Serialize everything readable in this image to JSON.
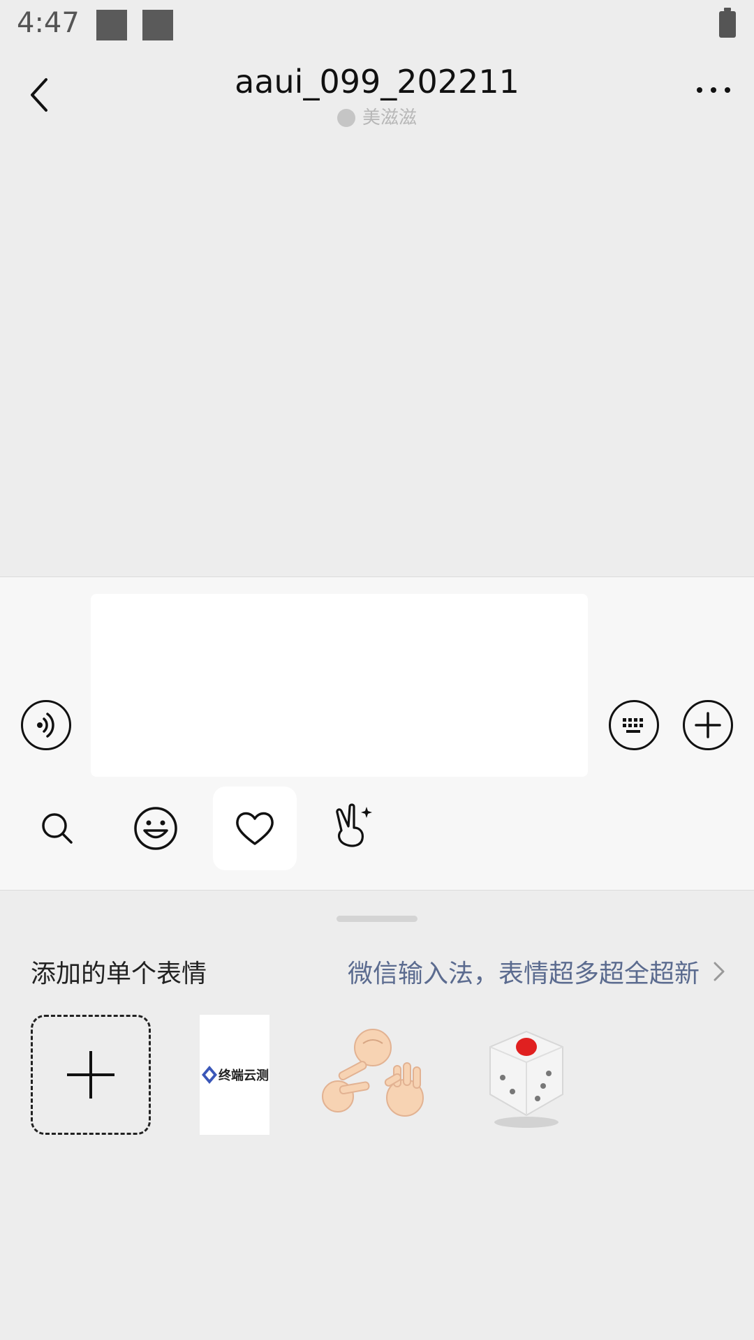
{
  "status": {
    "time": "4:47"
  },
  "header": {
    "title": "aaui_099_202211",
    "subtitle": "美滋滋"
  },
  "emoji_panel": {
    "section_title": "添加的单个表情",
    "promo_link": "微信输入法，表情超多超全超新",
    "stickers": [
      {
        "name": "add",
        "label": ""
      },
      {
        "name": "logo",
        "label": "终端云测"
      },
      {
        "name": "rock-paper-scissors",
        "label": ""
      },
      {
        "name": "dice",
        "label": ""
      }
    ]
  },
  "colors": {
    "background": "#EDEDED",
    "composer": "#F7F7F7",
    "link": "#5b6b8f",
    "dice_dot": "#e02020"
  },
  "icons": {
    "back": "chevron-left-icon",
    "more": "more-icon",
    "voice": "voice-icon",
    "keyboard": "keyboard-icon",
    "plus": "plus-circle-icon",
    "search": "search-icon",
    "emoji": "smiley-icon",
    "favorites": "heart-icon",
    "gesture": "victory-hand-icon"
  }
}
